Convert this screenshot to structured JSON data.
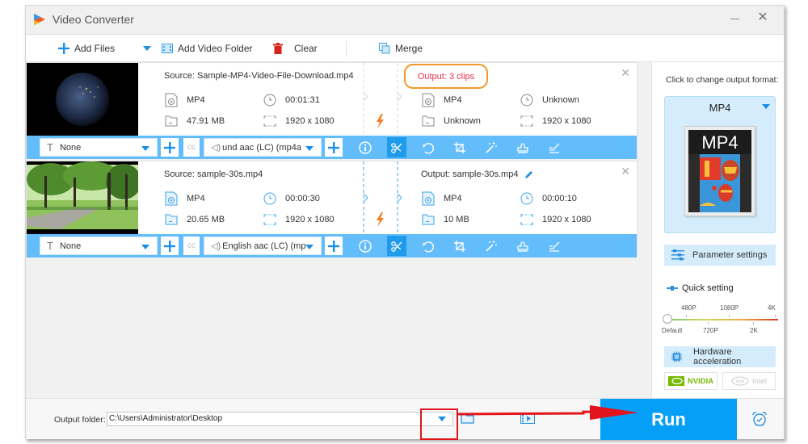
{
  "window": {
    "title": "Video Converter",
    "minimize_icon": "minimize-icon",
    "close_icon": "close-icon"
  },
  "toolbar": {
    "add_files": "Add Files",
    "add_video_folder": "Add Video Folder",
    "clear": "Clear",
    "merge": "Merge"
  },
  "files": [
    {
      "source_label": "Source: Sample-MP4-Video-File-Download.mp4",
      "source": {
        "format": "MP4",
        "duration": "00:01:31",
        "size": "47.91 MB",
        "resolution": "1920 x 1080"
      },
      "output_label": "Output: 3 clips",
      "output_highlighted": true,
      "output": {
        "format": "MP4",
        "duration": "Unknown",
        "size": "Unknown",
        "resolution": "1920 x 1080"
      },
      "subtitle": "None",
      "audio": "und aac (LC) (mp4a",
      "thumbnail": "earth-at-night"
    },
    {
      "source_label": "Source: sample-30s.mp4",
      "source": {
        "format": "MP4",
        "duration": "00:00:30",
        "size": "20.65 MB",
        "resolution": "1920 x 1080"
      },
      "output_label": "Output: sample-30s.mp4",
      "output_highlighted": false,
      "output": {
        "format": "MP4",
        "duration": "00:00:10",
        "size": "10 MB",
        "resolution": "1920 x 1080"
      },
      "subtitle": "None",
      "audio": "English aac (LC) (mp",
      "thumbnail": "park-trees"
    }
  ],
  "edit_tools": [
    "info-icon",
    "scissors-icon",
    "rotate-icon",
    "crop-icon",
    "effects-wand-icon",
    "watermark-stamp-icon",
    "subtitle-edit-icon"
  ],
  "right_panel": {
    "change_format_label": "Click to change output format:",
    "format": "MP4",
    "format_icon_text": "MP4",
    "parameter_settings": "Parameter settings",
    "quick_setting": "Quick setting",
    "quality_top_labels": [
      "480P",
      "1080P",
      "4K"
    ],
    "quality_bottom_labels": [
      "Default",
      "720P",
      "2K"
    ],
    "quality_selected": "Default",
    "hardware_acceleration": "Hardware acceleration",
    "gpu_options": [
      {
        "label": "NVIDIA",
        "enabled": true
      },
      {
        "label": "Intel",
        "enabled": false
      }
    ]
  },
  "bottom": {
    "output_folder_label": "Output folder:",
    "output_folder_value": "C:\\Users\\Administrator\\Desktop",
    "run_label": "Run"
  },
  "colors": {
    "accent_blue": "#069ff7",
    "editbar_blue": "#64bdfb",
    "highlight_orange": "#f0982d",
    "output_red_text": "#e8304a",
    "annotation_red": "#e3141b",
    "nvidia_green": "#76b900"
  }
}
